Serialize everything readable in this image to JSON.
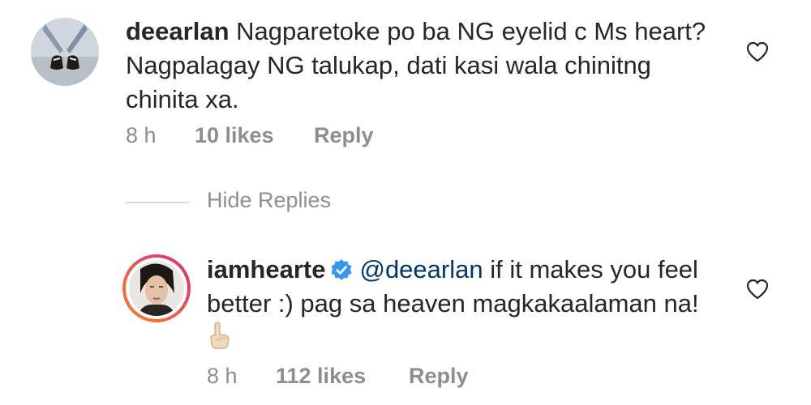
{
  "comments": [
    {
      "username": "deearlan",
      "text": "Nagparetoke po ba NG eyelid c Ms heart? Nagpalagay NG talukap, dati kasi wala chinitng chinita xa.",
      "time": "8 h",
      "likes": "10 likes",
      "reply_label": "Reply"
    }
  ],
  "hide_replies_label": "Hide Replies",
  "replies": [
    {
      "username": "iamhearte",
      "verified": true,
      "mention": "@deearlan",
      "text": "if it makes you feel better :) pag sa heaven magkakaalaman na!",
      "time": "8 h",
      "likes": "112 likes",
      "reply_label": "Reply"
    }
  ],
  "colors": {
    "text": "#262626",
    "meta": "#8e8e8e",
    "mention": "#00376b",
    "verified": "#3897f0",
    "story_ring_start": "#f58529",
    "story_ring_end": "#dd2a7b"
  },
  "icons": {
    "like": "heart-outline-icon",
    "verified": "verified-badge-icon",
    "emoji": "index-pointing-up-emoji"
  }
}
